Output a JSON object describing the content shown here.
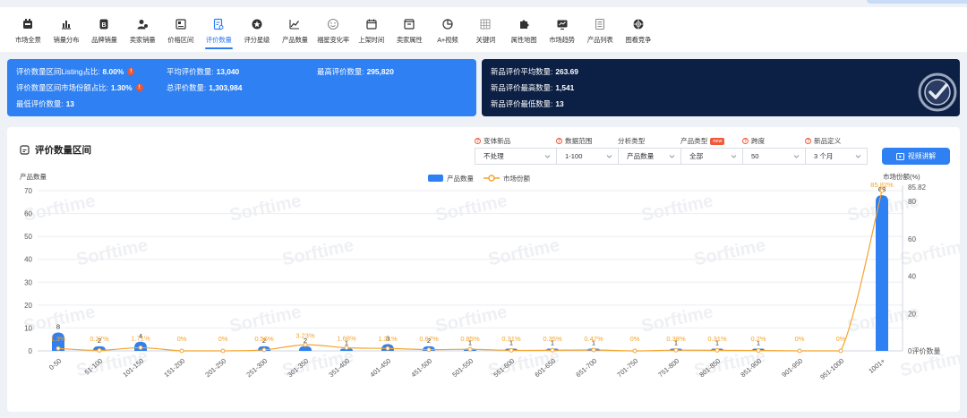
{
  "tabs": [
    {
      "label": "市场全景",
      "icon": "market-overview-icon"
    },
    {
      "label": "销量分布",
      "icon": "bar-chart-icon"
    },
    {
      "label": "品牌销量",
      "icon": "brand-icon"
    },
    {
      "label": "卖家销量",
      "icon": "seller-icon"
    },
    {
      "label": "价格区间",
      "icon": "price-range-icon"
    },
    {
      "label": "评价数量",
      "icon": "review-count-icon",
      "active": true
    },
    {
      "label": "评分星级",
      "icon": "star-icon"
    },
    {
      "label": "产品数量",
      "icon": "line-chart-icon"
    },
    {
      "label": "福星变化率",
      "icon": "smile-icon"
    },
    {
      "label": "上架时间",
      "icon": "calendar-icon"
    },
    {
      "label": "卖家属性",
      "icon": "shop-icon"
    },
    {
      "label": "A+视频",
      "icon": "pie-icon"
    },
    {
      "label": "关键词",
      "icon": "keyword-icon"
    },
    {
      "label": "属性地图",
      "icon": "puzzle-icon"
    },
    {
      "label": "市场趋势",
      "icon": "trend-icon"
    },
    {
      "label": "产品列表",
      "icon": "list-icon"
    },
    {
      "label": "图看竞争",
      "icon": "competition-icon"
    }
  ],
  "stats_left": [
    {
      "label": "评价数量区间Listing占比:",
      "value": "8.00%",
      "warn": true
    },
    {
      "label": "评价数量区间市场份额占比:",
      "value": "1.30%",
      "warn": true
    },
    {
      "label": "最低评价数量:",
      "value": "13"
    },
    {
      "label": "平均评价数量:",
      "value": "13,040"
    },
    {
      "label": "总评价数量:",
      "value": "1,303,984"
    },
    {
      "label": "最高评价数量:",
      "value": "295,820"
    }
  ],
  "stats_right": [
    {
      "label": "新品评价平均数量:",
      "value": "263.69"
    },
    {
      "label": "新品评价最高数量:",
      "value": "1,541"
    },
    {
      "label": "新品评价最低数量:",
      "value": "13"
    }
  ],
  "card": {
    "title": "评价数量区间",
    "video_button": "视频讲解"
  },
  "filters": [
    {
      "label": "变体新品",
      "value": "不处理",
      "help": true
    },
    {
      "label": "数据范围",
      "value": "1-100",
      "help": true
    },
    {
      "label": "分析类型",
      "value": "产品数量",
      "help": false
    },
    {
      "label": "产品类型",
      "value": "全部",
      "help": false,
      "badge": "new"
    },
    {
      "label": "跨度",
      "value": "50",
      "help": true
    },
    {
      "label": "新品定义",
      "value": "3 个月",
      "help": true
    }
  ],
  "watermark": "Sorftime",
  "colors": {
    "accent": "#2f80f2",
    "dark": "#0c1f45",
    "line": "#f5a42c",
    "warn": "#f0552e"
  },
  "chart_data": {
    "type": "bar",
    "categories": [
      "0-50",
      "51-100",
      "101-150",
      "151-200",
      "201-250",
      "251-300",
      "301-350",
      "351-400",
      "401-450",
      "451-500",
      "501-550",
      "551-600",
      "601-650",
      "651-700",
      "701-750",
      "751-800",
      "801-850",
      "851-900",
      "901-950",
      "951-1000",
      "1001+"
    ],
    "ylabel_left": "产品数量",
    "ylabel_right": "市场份额(%)",
    "ylim_left": [
      0,
      70
    ],
    "yticks_left": [
      "0",
      "10",
      "20",
      "30",
      "40",
      "50",
      "60",
      "70"
    ],
    "ylim_right": [
      0,
      85.82
    ],
    "yticks_right": [
      "0评价数量",
      "20",
      "40",
      "60",
      "80"
    ],
    "ymax_right_label": "85.82",
    "grid": true,
    "legend_position": "top-center",
    "series": [
      {
        "name": "产品数量",
        "kind": "bar",
        "values": [
          8,
          2,
          4,
          0,
          0,
          2,
          2,
          1,
          3,
          2,
          1,
          1,
          1,
          1,
          0,
          1,
          1,
          1,
          0,
          0,
          68
        ],
        "labels": [
          "8",
          "2",
          "4",
          "",
          "",
          "2",
          "2",
          "1",
          "3",
          "2",
          "1",
          "1",
          "1",
          "1",
          "",
          "1",
          "1",
          "1",
          "",
          "",
          "68"
        ]
      },
      {
        "name": "市场份额",
        "kind": "line",
        "values": [
          1.3,
          0.27,
          1.71,
          0,
          0,
          0.56,
          3.23,
          1.68,
          1.31,
          0.67,
          0.85,
          0.31,
          0.35,
          0.47,
          0,
          0.38,
          0.31,
          0.2,
          0,
          0,
          85.82
        ],
        "labels": [
          "1.3%",
          "0.27%",
          "1.71%",
          "0%",
          "0%",
          "0.56%",
          "3.23%",
          "1.68%",
          "1.31%",
          "0.67%",
          "0.85%",
          "0.31%",
          "0.35%",
          "0.47%",
          "0%",
          "0.38%",
          "0.31%",
          "0.2%",
          "0%",
          "0%",
          "85.82%"
        ]
      }
    ]
  }
}
